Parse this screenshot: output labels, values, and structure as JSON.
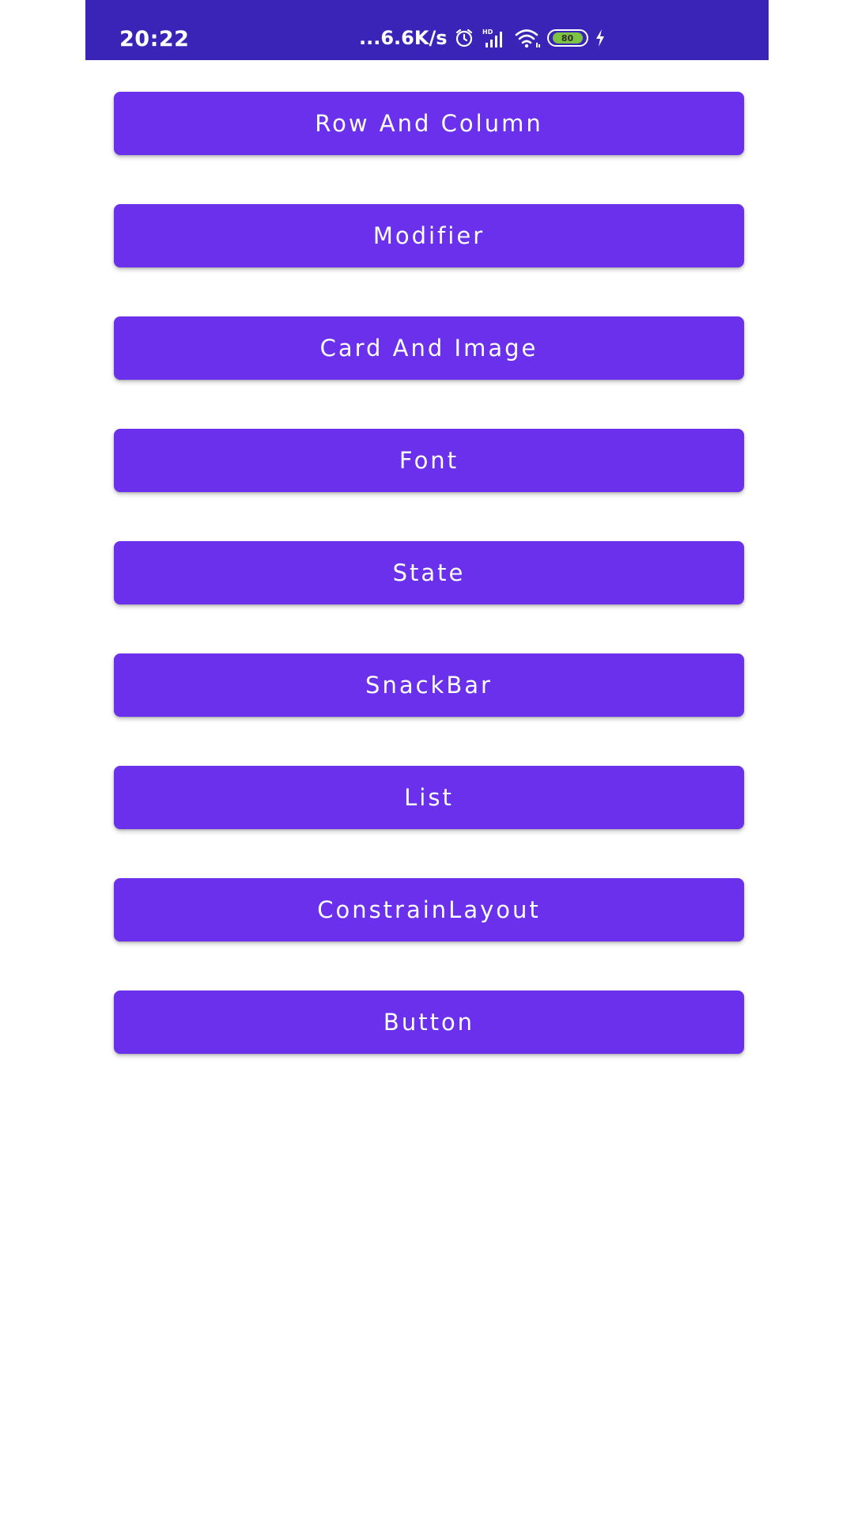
{
  "status_bar": {
    "time": "20:22",
    "net_speed": "...6.6K/s",
    "battery_level": "80",
    "icons": [
      "alarm-icon",
      "hd-signal-icon",
      "wifi-icon",
      "battery-icon",
      "charging-icon"
    ],
    "background_color": "#3A24B8"
  },
  "buttons": [
    {
      "label": "Row And Column"
    },
    {
      "label": "Modifier"
    },
    {
      "label": "Card And Image"
    },
    {
      "label": "Font"
    },
    {
      "label": "State"
    },
    {
      "label": "SnackBar"
    },
    {
      "label": "List"
    },
    {
      "label": "ConstrainLayout"
    },
    {
      "label": "Button"
    }
  ],
  "colors": {
    "button_background": "#6A30EC",
    "button_text": "#FFFFFF",
    "page_background": "#FFFFFF"
  }
}
